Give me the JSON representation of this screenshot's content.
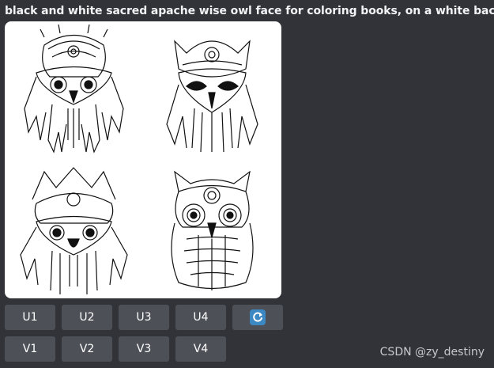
{
  "prompt": {
    "text": "black and white sacred apache wise owl face for coloring books, on a white background"
  },
  "image_grid": {
    "images": [
      {
        "subject": "owl-headdress-1"
      },
      {
        "subject": "owl-headdress-2"
      },
      {
        "subject": "owl-headdress-3"
      },
      {
        "subject": "owl-headdress-4"
      }
    ]
  },
  "actions": {
    "upscale": [
      "U1",
      "U2",
      "U3",
      "U4"
    ],
    "variation": [
      "V1",
      "V2",
      "V3",
      "V4"
    ],
    "reroll_icon": "reroll-icon"
  },
  "watermark": {
    "text": "CSDN @zy_destiny"
  },
  "colors": {
    "background": "#313338",
    "button": "#4e5058",
    "reroll_accent": "#3b88c3"
  }
}
